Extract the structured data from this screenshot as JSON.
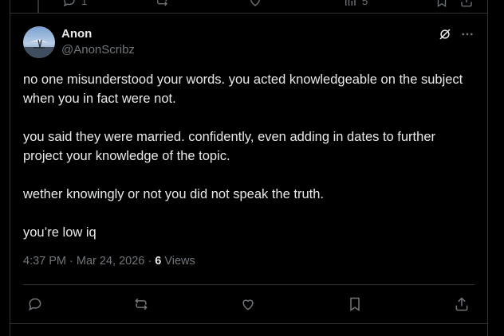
{
  "previous_post": {
    "reply_count": "1",
    "views_count": "5"
  },
  "post": {
    "author_name": "Anon",
    "author_handle": "@AnonScribz",
    "paragraphs": [
      "no one misunderstood your words. you acted knowledgeable on the subject when you in fact were not.",
      "you said they were married. confidently, even adding in dates to further project your knowledge of the topic.",
      "wether knowingly or not you did not speak the truth.",
      "you’re low iq"
    ],
    "time": "4:37 PM",
    "date": "Mar 24, 2026",
    "views_count": "6",
    "views_label": "Views"
  },
  "icons": {
    "reply": "reply-icon",
    "repost": "repost-icon",
    "like": "like-icon",
    "bookmark": "bookmark-icon",
    "share": "share-icon",
    "views": "views-icon",
    "grok": "grok-icon",
    "more": "more-icon"
  },
  "colors": {
    "background": "#000000",
    "text_primary": "#e7e9ea",
    "text_secondary": "#71767b",
    "border": "#2f3336"
  }
}
